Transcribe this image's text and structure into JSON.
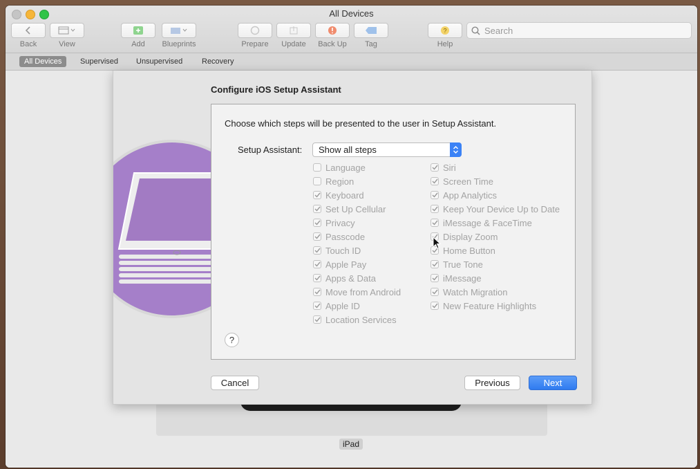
{
  "window": {
    "title": "All Devices"
  },
  "toolbar": {
    "back_label": "Back",
    "view_label": "View",
    "add_label": "Add",
    "blueprints_label": "Blueprints",
    "prepare_label": "Prepare",
    "update_label": "Update",
    "backup_label": "Back Up",
    "tag_label": "Tag",
    "help_label": "Help",
    "search_placeholder": "Search"
  },
  "scope_tabs": [
    {
      "label": "All Devices",
      "active": true
    },
    {
      "label": "Supervised",
      "active": false
    },
    {
      "label": "Unsupervised",
      "active": false
    },
    {
      "label": "Recovery",
      "active": false
    }
  ],
  "device": {
    "label": "iPad"
  },
  "sheet": {
    "title": "Configure iOS Setup Assistant",
    "instruction": "Choose which steps will be presented to the user in Setup Assistant.",
    "setup_label": "Setup Assistant:",
    "setup_value": "Show all steps",
    "left_steps": [
      {
        "label": "Language",
        "checked": false
      },
      {
        "label": "Region",
        "checked": false
      },
      {
        "label": "Keyboard",
        "checked": true
      },
      {
        "label": "Set Up Cellular",
        "checked": true
      },
      {
        "label": "Privacy",
        "checked": true
      },
      {
        "label": "Passcode",
        "checked": true
      },
      {
        "label": "Touch ID",
        "checked": true
      },
      {
        "label": "Apple Pay",
        "checked": true
      },
      {
        "label": "Apps & Data",
        "checked": true
      },
      {
        "label": "Move from Android",
        "checked": true
      },
      {
        "label": "Apple ID",
        "checked": true
      },
      {
        "label": "Location Services",
        "checked": true
      }
    ],
    "right_steps": [
      {
        "label": "Siri",
        "checked": true
      },
      {
        "label": "Screen Time",
        "checked": true
      },
      {
        "label": "App Analytics",
        "checked": true
      },
      {
        "label": "Keep Your Device Up to Date",
        "checked": true
      },
      {
        "label": "iMessage & FaceTime",
        "checked": true
      },
      {
        "label": "Display Zoom",
        "checked": true
      },
      {
        "label": "Home Button",
        "checked": true
      },
      {
        "label": "True Tone",
        "checked": true
      },
      {
        "label": "iMessage",
        "checked": true
      },
      {
        "label": "Watch Migration",
        "checked": true
      },
      {
        "label": "New Feature Highlights",
        "checked": true
      }
    ],
    "help_label": "?",
    "cancel_label": "Cancel",
    "previous_label": "Previous",
    "next_label": "Next"
  },
  "colors": {
    "accent": "#2f7bf0",
    "circle": "#a57fc9"
  }
}
